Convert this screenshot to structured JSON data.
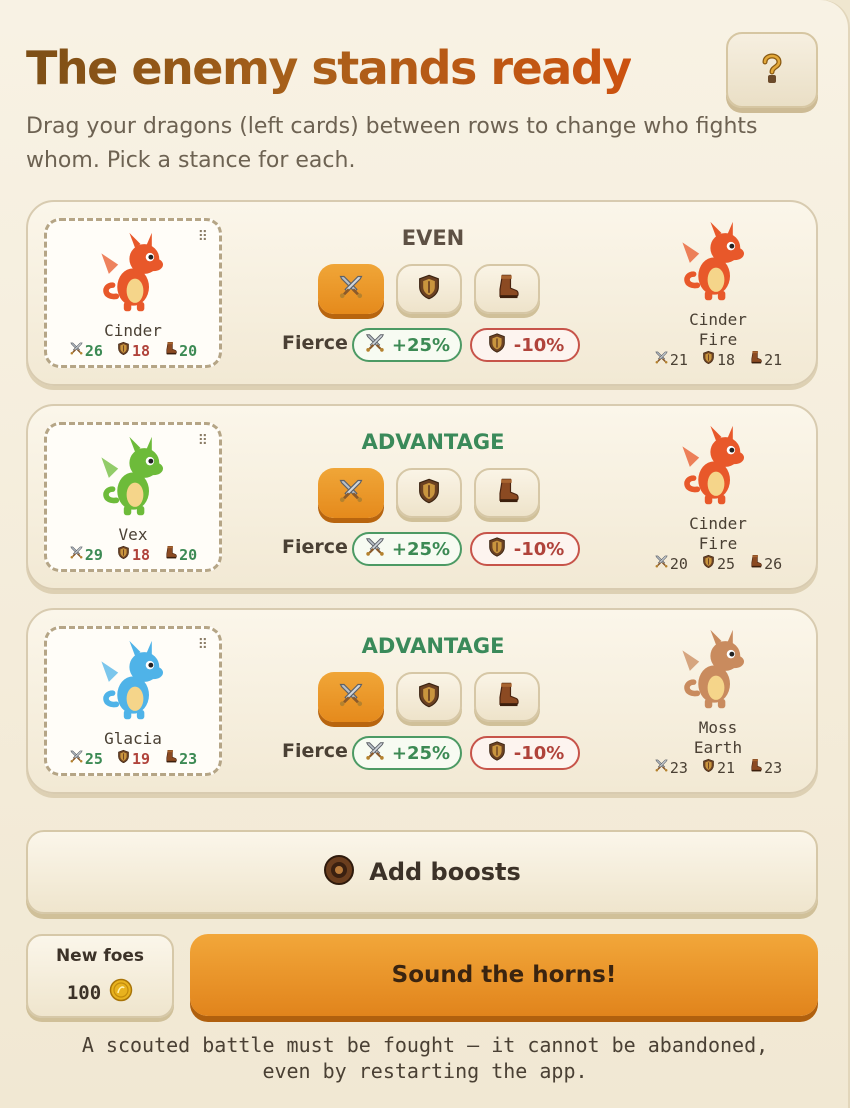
{
  "header": {
    "title": "The enemy stands ready",
    "subtitle": "Drag your dragons (left cards) between rows to change who fights whom. Pick a stance for each.",
    "help_icon": "question-mark-icon"
  },
  "colors": {
    "accent": "#e58a1c",
    "advantage": "#3a8a5a",
    "positive": "#3c8a54",
    "negative": "#b0433b"
  },
  "matchups": [
    {
      "verdict": "EVEN",
      "mine": {
        "name": "Cinder",
        "attack": "26",
        "defense": "18",
        "speed": "20",
        "color": "#e8582a"
      },
      "stance_label": "Fierce",
      "mod_positive": "+25%",
      "mod_negative": "-10%",
      "enemy": {
        "name": "Cinder",
        "element": "Fire",
        "attack": "21",
        "defense": "18",
        "speed": "21",
        "color": "#e8582a"
      }
    },
    {
      "verdict": "ADVANTAGE",
      "mine": {
        "name": "Vex",
        "attack": "29",
        "defense": "18",
        "speed": "20",
        "color": "#6dbb3a"
      },
      "stance_label": "Fierce",
      "mod_positive": "+25%",
      "mod_negative": "-10%",
      "enemy": {
        "name": "Cinder",
        "element": "Fire",
        "attack": "20",
        "defense": "25",
        "speed": "26",
        "color": "#e8582a"
      }
    },
    {
      "verdict": "ADVANTAGE",
      "mine": {
        "name": "Glacia",
        "attack": "25",
        "defense": "19",
        "speed": "23",
        "color": "#4fb3e8"
      },
      "stance_label": "Fierce",
      "mod_positive": "+25%",
      "mod_negative": "-10%",
      "enemy": {
        "name": "Moss",
        "element": "Earth",
        "attack": "23",
        "defense": "21",
        "speed": "23",
        "color": "#c98b5e"
      }
    }
  ],
  "stances": [
    "crossed-swords-icon",
    "shield-icon",
    "boot-icon"
  ],
  "boost": {
    "label": "Add boosts",
    "icon": "round-shield-icon"
  },
  "new_foes": {
    "label": "New foes",
    "cost": "100",
    "icon": "gold-coin-icon"
  },
  "horns": {
    "label": "Sound the horns!"
  },
  "footer": {
    "line1": "A scouted battle must be fought — it cannot be abandoned,",
    "line2": "even by restarting the app."
  }
}
